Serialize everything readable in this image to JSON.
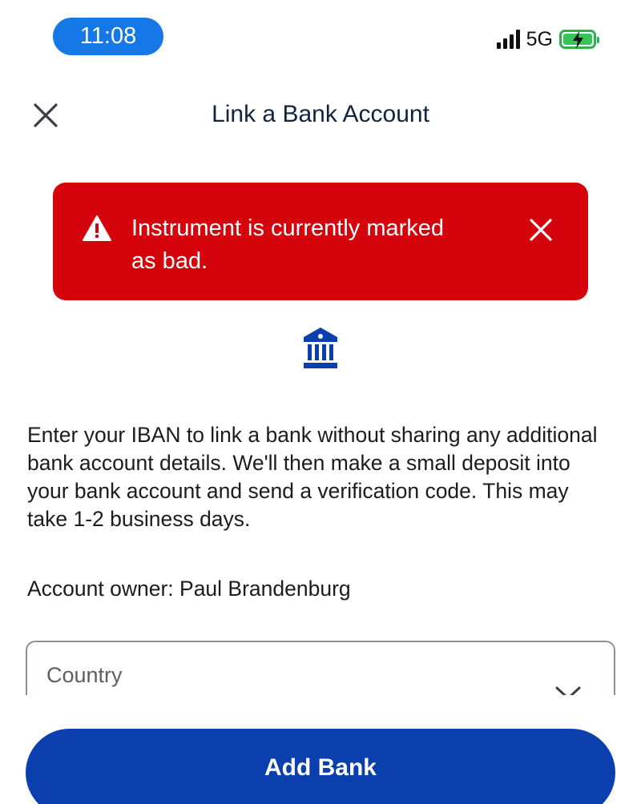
{
  "status_bar": {
    "time": "11:08",
    "network": "5G"
  },
  "header": {
    "title": "Link a Bank Account"
  },
  "alert": {
    "message": "Instrument is currently marked as bad."
  },
  "description": "Enter your IBAN to link a bank without sharing any additional bank account details. We'll then make a small deposit into your bank account and send a verification code. This may take 1-2 business days.",
  "owner": "Account owner: Paul Brandenburg",
  "country_select": {
    "label": "Country"
  },
  "add_button": {
    "label": "Add Bank"
  },
  "colors": {
    "accent": "#1677e6",
    "error": "#d5030c",
    "primary": "#0b3fad",
    "battery": "#38c558"
  }
}
